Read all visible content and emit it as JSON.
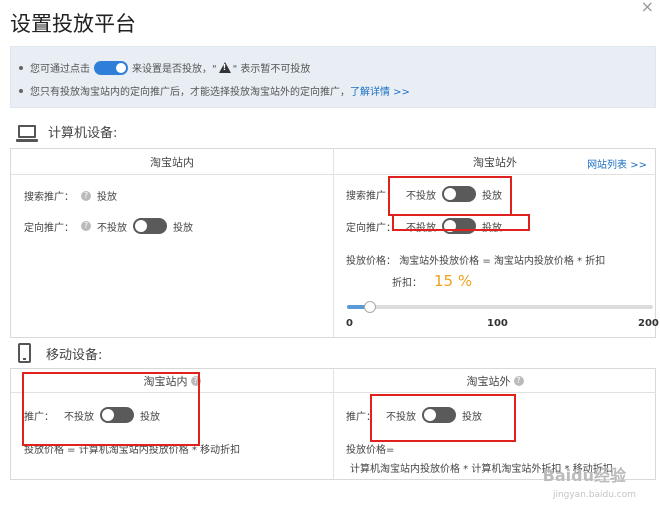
{
  "title": "设置投放平台",
  "close_label": "×",
  "notice": {
    "line1_prefix": "您可通过点击",
    "line1_middle": "来设置是否投放，\"",
    "line1_suffix": "\" 表示暂不可投放",
    "line2_text": "您只有投放淘宝站内的定向推广后，才能选择投放淘宝站外的定向推广，",
    "line2_link": "了解详情 >>"
  },
  "pc": {
    "section_title": "计算机设备:",
    "col_inside": "淘宝站内",
    "col_outside": "淘宝站外",
    "site_list_link": "网站列表 >>",
    "inside_search_label": "搜索推广：",
    "inside_search_value": "投放",
    "inside_target_label": "定向推广：",
    "inside_target_off": "不投放",
    "inside_target_on": "投放",
    "outside_search_label": "搜索推广：",
    "outside_search_off": "不投放",
    "outside_search_on": "投放",
    "outside_target_label": "定向推广：",
    "outside_target_off": "不投放",
    "outside_target_on": "投放",
    "price_label": "投放价格：",
    "price_formula": "淘宝站外投放价格 = 淘宝站内投放价格 * 折扣",
    "discount_label": "折扣：",
    "discount_value": "15 %",
    "slider_min": "0",
    "slider_mid": "100",
    "slider_max": "200",
    "slider_value": 15
  },
  "mobile": {
    "section_title": "移动设备:",
    "col_inside": "淘宝站内",
    "col_outside": "淘宝站外",
    "inside_label": "推广：",
    "inside_off": "不投放",
    "inside_on": "投放",
    "inside_price": "投放价格 = 计算机淘宝站内投放价格 * 移动折扣",
    "outside_label": "推广：",
    "outside_off": "不投放",
    "outside_on": "投放",
    "outside_price_label": "投放价格=",
    "outside_price_formula": "计算机淘宝站内投放价格 * 计算机淘宝站外折扣 * 移动折扣"
  },
  "watermark": "Baidu经验",
  "watermark_sub": "jingyan.baidu.com"
}
